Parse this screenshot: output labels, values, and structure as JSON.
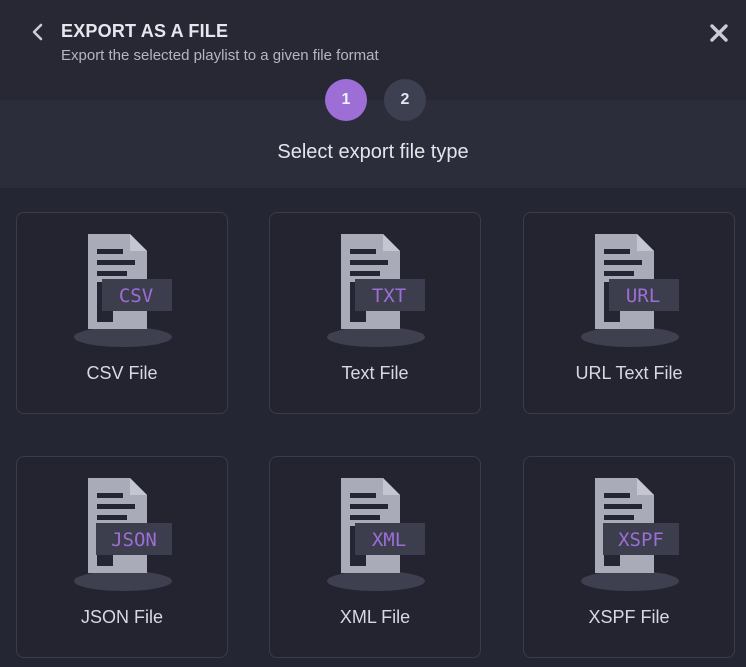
{
  "header": {
    "title": "EXPORT AS A FILE",
    "subtitle": "Export the selected playlist to a given file format"
  },
  "steps": [
    {
      "label": "1",
      "active": true
    },
    {
      "label": "2",
      "active": false
    }
  ],
  "section_title": "Select export file type",
  "file_types": [
    {
      "tag": "CSV",
      "label": "CSV File"
    },
    {
      "tag": "TXT",
      "label": "Text File"
    },
    {
      "tag": "URL",
      "label": "URL Text File"
    },
    {
      "tag": "JSON",
      "label": "JSON File"
    },
    {
      "tag": "XML",
      "label": "XML File"
    },
    {
      "tag": "XSPF",
      "label": "XSPF File"
    }
  ],
  "colors": {
    "accent": "#9c6ed6",
    "background": "#252633",
    "card_border": "#3a3c4a",
    "icon": "#a9abb9"
  },
  "icons": {
    "back": "chevron-left-icon",
    "close": "close-icon",
    "file": "document-icon"
  }
}
